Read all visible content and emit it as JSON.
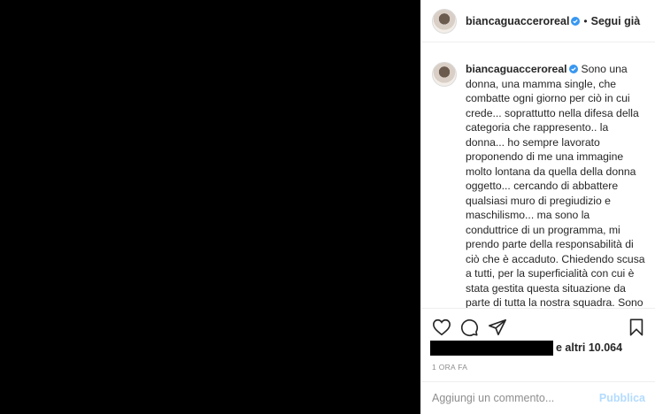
{
  "post": {
    "username": "biancaguacceroreal",
    "follow_label": "Segui già",
    "caption": "Sono una donna, una mamma single, che combatte ogni giorno per ciò in cui crede... soprattutto nella difesa della categoria che rappresento.. la donna... ho sempre lavorato proponendo di me una immagine molto lontana da quella della donna oggetto... cercando di abbattere qualsiasi muro di pregiudizio e maschilismo... ma sono la conduttrice di un programma, mi prendo parte della responsabilità di ciò che è accaduto. Chiedendo scusa a tutti, per la superficialità con cui è stata gestita questa situazione da parte di tutta la nostra squadra. Sono certa della buona fede del gruppo autorale che lavora da mesi,",
    "likes_text": "e altri 10.064",
    "timestamp": "1 ORA FA"
  },
  "comment": {
    "placeholder": "Aggiungi un commento...",
    "publish_label": "Pubblica"
  },
  "icons": {
    "like": "heart-icon",
    "comment": "comment-bubble-icon",
    "share": "paper-plane-icon",
    "save": "bookmark-icon",
    "verified": "verified-badge-icon"
  },
  "colors": {
    "verified": "#3897f0",
    "publish_disabled": "#b3dbff",
    "text": "#262626",
    "muted": "#8e8e8e"
  }
}
